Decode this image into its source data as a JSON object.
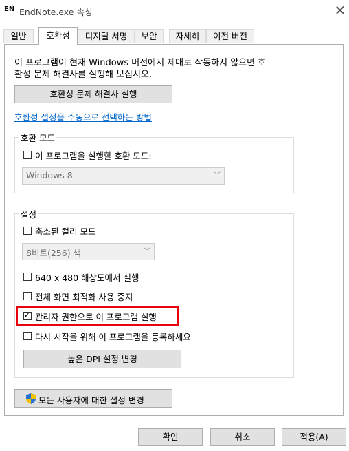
{
  "window": {
    "app_badge": "EN",
    "title": "EndNote.exe 속성",
    "close_glyph": "✕"
  },
  "tabs": [
    {
      "label": "일반"
    },
    {
      "label": "호환성"
    },
    {
      "label": "디지털 서명"
    },
    {
      "label": "보안"
    },
    {
      "label": "자세히"
    },
    {
      "label": "이전 버전"
    }
  ],
  "intro": {
    "line1": "이 프로그램이 현재 Windows 버전에서 제대로 작동하지 않으면 호",
    "line2": "환성 문제 해결사를 실행해 보십시오."
  },
  "troubleshooter_button": "호환성 문제 해결사 실행",
  "manual_link": "호환성 설정을 수동으로 선택하는 방법",
  "compat_mode": {
    "group_label": "호환 모드",
    "checkbox_label": "이 프로그램을 실행할 호환 모드:",
    "checked": false,
    "selected": "Windows 8"
  },
  "settings": {
    "group_label": "설정",
    "reduced_color": {
      "label": "축소된 컬러 모드",
      "checked": false
    },
    "color_select": "8비트(256) 색",
    "res_640": {
      "label": "640 x 480 해상도에서 실행",
      "checked": false
    },
    "disable_fullscreen": {
      "label": "전체 화면 최적화 사용 중지",
      "checked": false
    },
    "run_as_admin": {
      "label": "관리자 권한으로 이 프로그램 실행",
      "checked": true
    },
    "register_restart": {
      "label": "다시 시작을 위해 이 프로그램을 등록하세요",
      "checked": false
    },
    "dpi_button": "높은 DPI 설정 변경"
  },
  "all_users_button": "모든 사용자에 대한 설정 변경",
  "footer": {
    "ok": "확인",
    "cancel": "취소",
    "apply": "적용(A)"
  },
  "colors": {
    "highlight": "#e8000b",
    "link": "#0066cc",
    "shield_blue": "#2a6fd6",
    "shield_yellow": "#f5c400"
  }
}
